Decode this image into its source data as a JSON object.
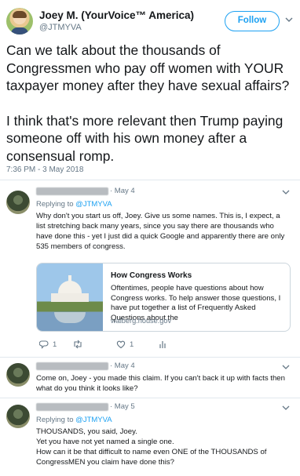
{
  "tweet": {
    "author_name": "Joey M. (YourVoice™ America)",
    "author_handle": "@JTMYVA",
    "follow_label": "Follow",
    "paragraphs": [
      "Can we talk about the thousands of Congressmen who pay off women with YOUR taxpayer money after they have sexual affairs?",
      "I think that's more relevant then Trump paying someone off with his own money after a consensual romp."
    ],
    "timestamp": "7:36 PM - 3 May 2018"
  },
  "replies": [
    {
      "date": "· May 4",
      "replying_prefix": "Replying to ",
      "replying_to": "@JTMYVA",
      "body": "Why don't you start us off, Joey. Give us some names. This is, I expect, a list stretching back many years, since you say there are thousands who have done this - yet I just did a quick Google and apparently there are only 535 members of congress.",
      "card": {
        "title": "How Congress Works",
        "description": "Oftentimes, people have questions about how Congress works.  To help answer those questions, I have put together a list of Frequently Asked Questions about the",
        "domain": "walberg.house.gov"
      },
      "actions": {
        "reply_count": "1",
        "retweet_count": "",
        "like_count": "1"
      }
    },
    {
      "date": "· May 4",
      "body": "Come on, Joey - you made this claim. If you can't back it up with facts then what do you think it looks like?"
    },
    {
      "date": "· May 5",
      "replying_prefix": "Replying to ",
      "replying_to": "@JTMYVA",
      "lines": [
        "THOUSANDS, you said, Joey.",
        "Yet you have not yet named a single one.",
        "How can it be that difficult to name even ONE of the THOUSANDS of CongressMEN you claim have done this?"
      ]
    }
  ],
  "colors": {
    "accent": "#1da1f2",
    "secondary_text": "#657786",
    "divider": "#e1e8ed"
  }
}
